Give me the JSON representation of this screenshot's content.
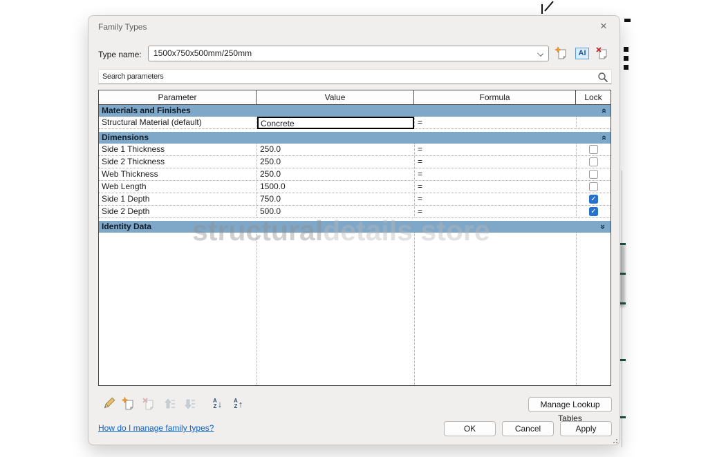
{
  "dialog": {
    "title": "Family Types",
    "type_name_label": "Type name:",
    "type_name_value": "1500x750x500mm/250mm",
    "search_placeholder": "Search parameters",
    "rename_icon_text": "AI"
  },
  "icons": {
    "top": [
      "new-type-icon",
      "rename-type-icon",
      "delete-type-icon"
    ],
    "bottom": [
      "edit-parameter-icon",
      "new-parameter-icon",
      "delete-parameter-icon",
      "move-up-icon",
      "move-down-icon",
      "sort-ascending-icon",
      "sort-descending-icon"
    ],
    "search": "search-icon",
    "close": "close-icon"
  },
  "table": {
    "columns": [
      "Parameter",
      "Value",
      "Formula",
      "Lock"
    ],
    "groups": [
      {
        "label": "Materials and Finishes",
        "collapsed": false,
        "rows": [
          {
            "parameter": "Structural Material (default)",
            "value": "Concrete",
            "formula_sign": "=",
            "lock": null,
            "selected": true
          }
        ]
      },
      {
        "label": "Dimensions",
        "collapsed": false,
        "rows": [
          {
            "parameter": "Side 1 Thickness",
            "value": "250.0",
            "formula_sign": "=",
            "lock": false
          },
          {
            "parameter": "Side 2 Thickness",
            "value": "250.0",
            "formula_sign": "=",
            "lock": false
          },
          {
            "parameter": "Web Thickness",
            "value": "250.0",
            "formula_sign": "=",
            "lock": false
          },
          {
            "parameter": "Web Length",
            "value": "1500.0",
            "formula_sign": "=",
            "lock": false
          },
          {
            "parameter": "Side 1 Depth",
            "value": "750.0",
            "formula_sign": "=",
            "lock": true
          },
          {
            "parameter": "Side 2 Depth",
            "value": "500.0",
            "formula_sign": "=",
            "lock": true
          }
        ]
      },
      {
        "label": "Identity Data",
        "collapsed": true,
        "rows": []
      }
    ]
  },
  "buttons": {
    "manage_lookup_tables": "Manage Lookup Tables",
    "ok": "OK",
    "cancel": "Cancel",
    "apply": "Apply"
  },
  "help_link": "How do I manage family types?",
  "watermark": {
    "part1": "structural",
    "part2": "details store"
  },
  "colors": {
    "group_header": "#7fa7c7",
    "checkbox_checked": "#2571cd",
    "link": "#0d62c9",
    "dialog_bg": "#f1efee"
  }
}
